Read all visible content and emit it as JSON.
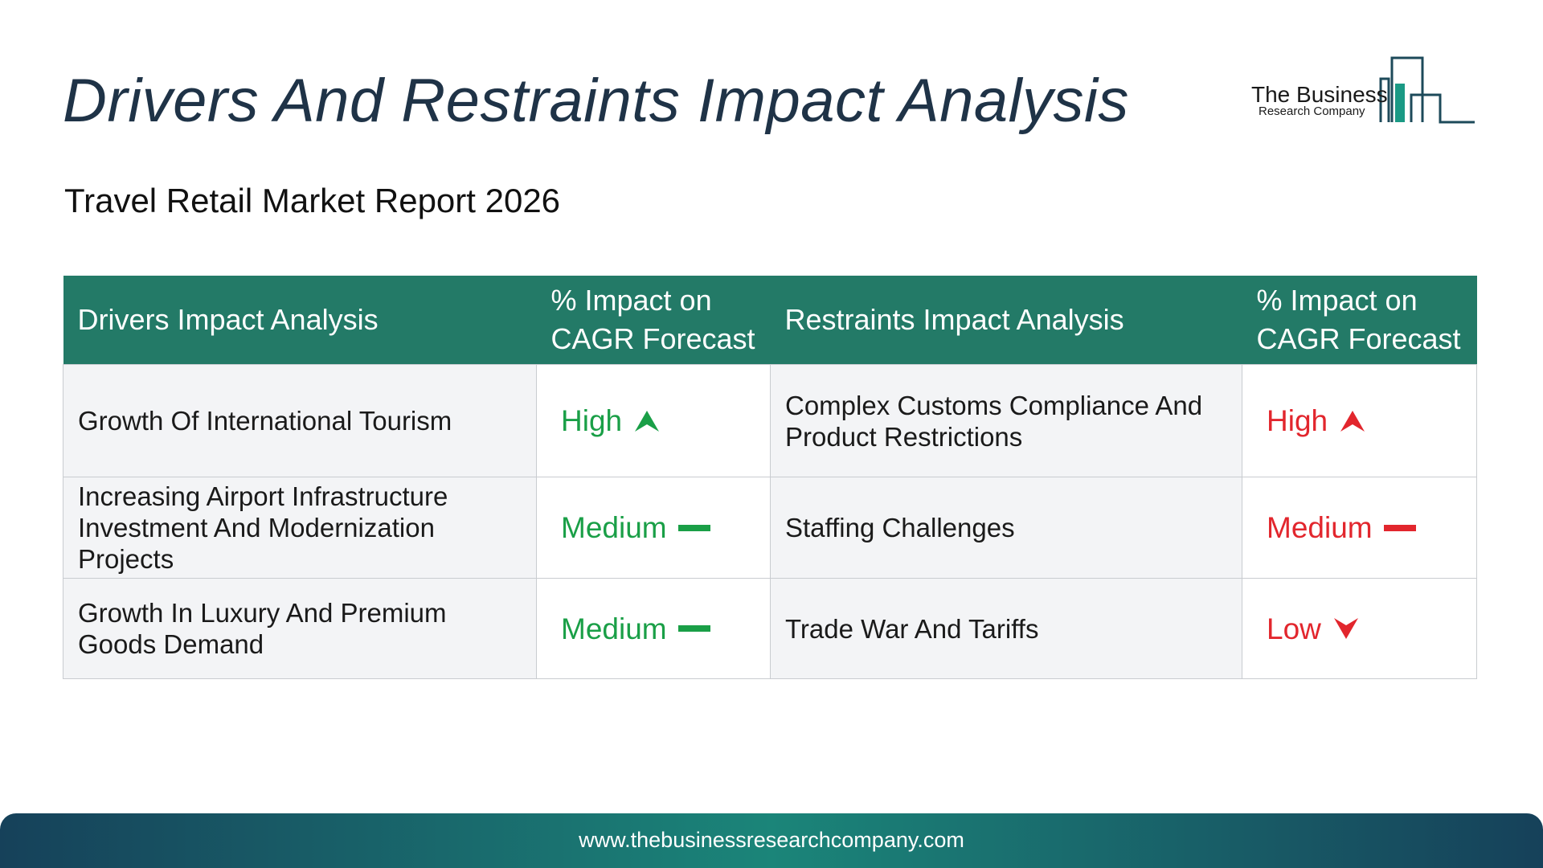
{
  "header": {
    "title": "Drivers And Restraints Impact Analysis",
    "subtitle": "Travel Retail Market Report 2026"
  },
  "logo": {
    "line1": "The Business",
    "line2": "Research Company"
  },
  "table": {
    "columns": [
      "Drivers Impact Analysis",
      "% Impact on CAGR Forecast",
      "Restraints Impact Analysis",
      "% Impact on CAGR Forecast"
    ],
    "rows": [
      {
        "driver": "Growth Of International Tourism",
        "driver_impact": "High",
        "driver_indicator": "up-arrow-icon",
        "restraint": "Complex Customs Compliance And Product Restrictions",
        "restraint_impact": "High",
        "restraint_indicator": "up-arrow-icon"
      },
      {
        "driver": "Increasing Airport Infrastructure Investment And Modernization Projects",
        "driver_impact": "Medium",
        "driver_indicator": "dash-icon",
        "restraint": "Staffing Challenges",
        "restraint_impact": "Medium",
        "restraint_indicator": "dash-icon"
      },
      {
        "driver": "Growth In Luxury And Premium Goods Demand",
        "driver_impact": "Medium",
        "driver_indicator": "dash-icon",
        "restraint": "Trade War And Tariffs",
        "restraint_impact": "Low",
        "restraint_indicator": "down-arrow-icon"
      }
    ]
  },
  "footer": {
    "url": "www.thebusinessresearchcompany.com"
  },
  "colors": {
    "header_bg": "#237a67",
    "driver_color": "#1a9f47",
    "restraint_color": "#e2262d",
    "title_color": "#1f3347"
  }
}
